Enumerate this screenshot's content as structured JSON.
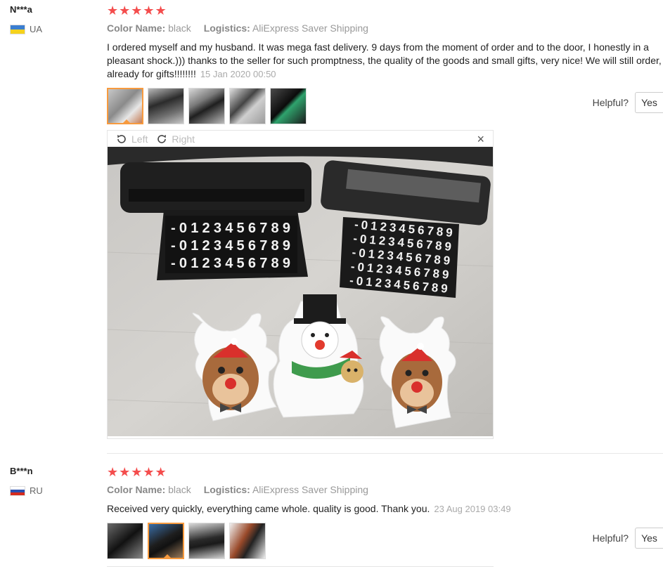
{
  "reviews": [
    {
      "user": "N***a",
      "country": "UA",
      "stars": "★★★★★",
      "color_key": "Color Name:",
      "color_val": "black",
      "logistics_key": "Logistics:",
      "logistics_val": "AliExpress Saver Shipping",
      "text": "I ordered myself and my husband. It was mega fast delivery. 9 days from the moment of order and to the door, I honestly in a pleasant shock.))) thanks to the seller for such promptness, the quality of the goods and small gifts, very nice! We will still order, already for gifts!!!!!!!!",
      "date": "15 Jan 2020 00:50",
      "helpful_label": "Helpful?",
      "yes_label": "Yes"
    },
    {
      "user": "B***n",
      "country": "RU",
      "stars": "★★★★★",
      "color_key": "Color Name:",
      "color_val": "black",
      "logistics_key": "Logistics:",
      "logistics_val": "AliExpress Saver Shipping",
      "text": "Received very quickly, everything came whole. quality is good. Thank you.",
      "date": "23 Aug 2019 03:49",
      "helpful_label": "Helpful?",
      "yes_label": "Yes"
    }
  ],
  "viewer": {
    "left_label": "Left",
    "right_label": "Right",
    "close_glyph": "×",
    "digits": "-0123456789",
    "icons": [
      "rotate-left-icon",
      "rotate-right-icon",
      "close-icon"
    ]
  },
  "colors": {
    "star": "#f44d4d",
    "active_thumb": "#f79a3e"
  }
}
